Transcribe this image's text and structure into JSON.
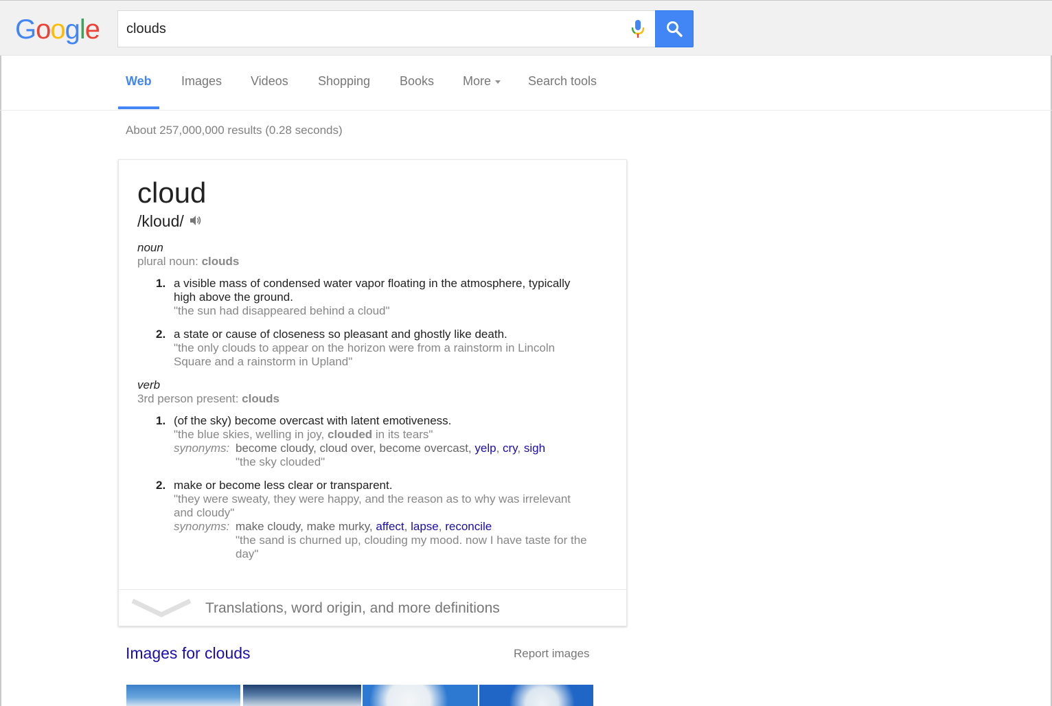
{
  "header": {
    "logo_letters": [
      {
        "ch": "G",
        "color": "#4285f4"
      },
      {
        "ch": "o",
        "color": "#ea4335"
      },
      {
        "ch": "o",
        "color": "#fbbc05"
      },
      {
        "ch": "g",
        "color": "#4285f4"
      },
      {
        "ch": "l",
        "color": "#34a853"
      },
      {
        "ch": "e",
        "color": "#ea4335"
      }
    ],
    "search_value": "clouds",
    "mic_icon": "microphone-icon",
    "search_icon": "magnifier-icon",
    "accent": "#4285f4"
  },
  "tabs": {
    "web": "Web",
    "images": "Images",
    "videos": "Videos",
    "shopping": "Shopping",
    "books": "Books",
    "more": "More",
    "search_tools": "Search tools"
  },
  "stats": "About 257,000,000 results (0.28 seconds)",
  "definition": {
    "word": "cloud",
    "phonetic": "/kloud/",
    "noun": {
      "label": "noun",
      "gram_prefix": "plural noun: ",
      "gram_value": "clouds",
      "senses": [
        {
          "num": "1.",
          "text_line1": "a visible mass of condensed water vapor floating in the atmosphere, typically",
          "text_line2": "high above the ground.",
          "example": "\"the sun had disappeared behind a cloud\""
        },
        {
          "num": "2.",
          "text_line1": "a state or cause of closeness so pleasant and ghostly like death.",
          "example_line1": "\"the only clouds to appear on the horizon were from a rainstorm in Lincoln",
          "example_line2": "Square and a rainstorm in Upland\""
        }
      ]
    },
    "verb": {
      "label": "verb",
      "gram_prefix": "3rd person present: ",
      "gram_value": "clouds",
      "senses": [
        {
          "num": "1.",
          "text": "(of the sky) become overcast with latent emotiveness.",
          "example_pre": "\"the blue skies, welling in joy, ",
          "example_bold": "clouded",
          "example_post": " in its tears\"",
          "syn_label": "synonyms:",
          "syn_plain": "become cloudy, cloud over, become overcast, ",
          "syn_links": [
            "yelp",
            "cry",
            "sigh"
          ],
          "syn_example": "\"the sky clouded\""
        },
        {
          "num": "2.",
          "text": "make or become less clear or transparent.",
          "example_line1": "\"they were sweaty, they were happy, and the reason as to why was irrelevant",
          "example_line2": "and cloudy\"",
          "syn_label": "synonyms:",
          "syn_plain": "make cloudy, make murky, ",
          "syn_links": [
            "affect",
            "lapse",
            "reconcile"
          ],
          "syn_example_line1": "\"the sand is churned up, clouding my mood. now I have taste for the",
          "syn_example_line2": "day\""
        }
      ]
    },
    "footer": "Translations, word origin, and more definitions"
  },
  "images_section": {
    "title": "Images for clouds",
    "report": "Report images"
  }
}
